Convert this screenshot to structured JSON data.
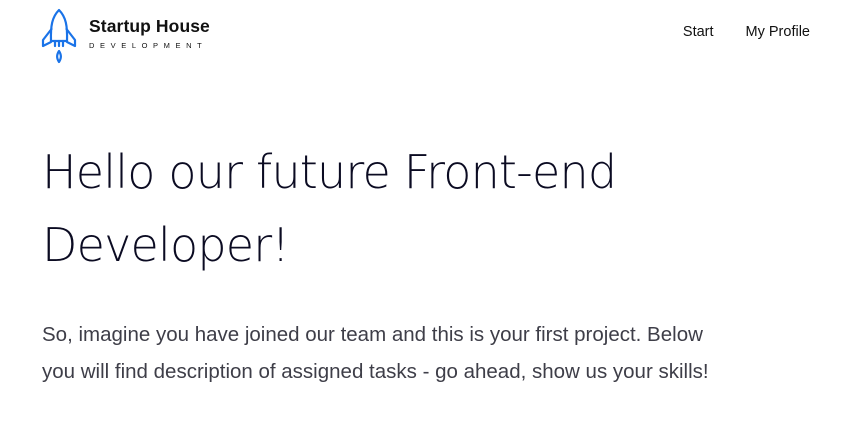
{
  "colors": {
    "accent": "#1a73e8",
    "text": "#0b0b22",
    "body_text": "#3e3e48",
    "background": "#ffffff"
  },
  "brand": {
    "icon": "rocket-icon",
    "name": "Startup House",
    "tagline": "DEVELOPMENT"
  },
  "nav": {
    "items": [
      {
        "label": "Start"
      },
      {
        "label": "My Profile"
      }
    ]
  },
  "hero": {
    "title": "Hello our future Front-end Developer!"
  },
  "intro": {
    "text": "So, imagine you have joined our team and this is your first project. Below you will find description of assigned tasks - go ahead, show us your skills!"
  }
}
